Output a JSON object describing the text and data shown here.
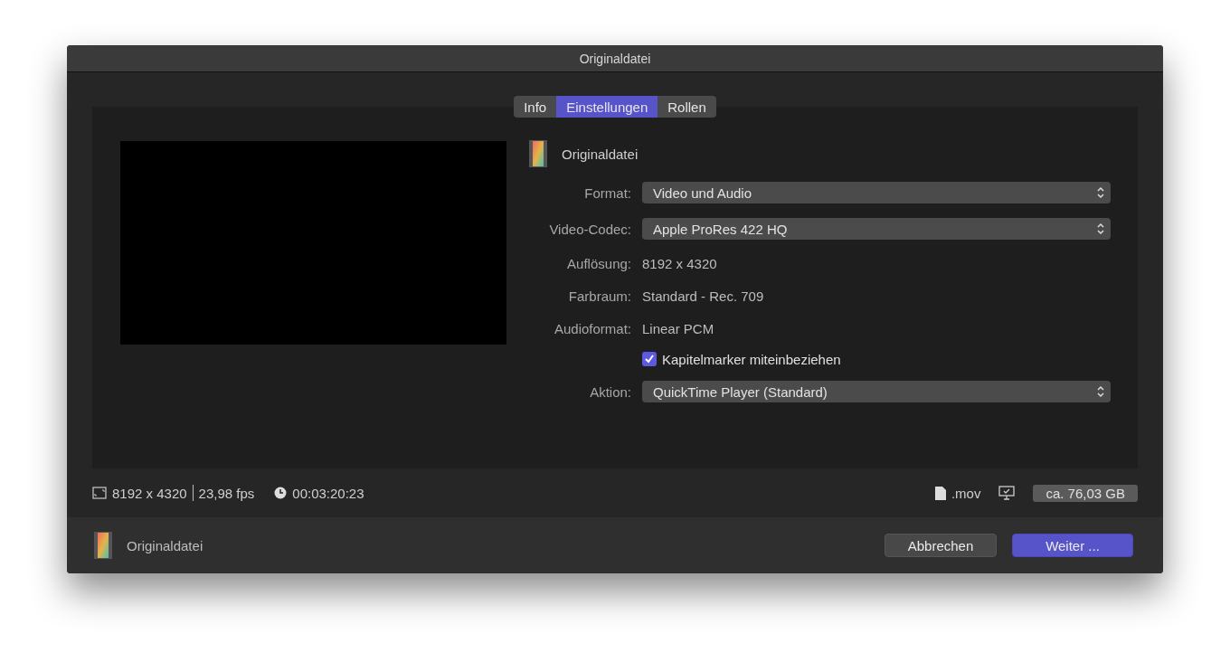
{
  "window": {
    "title": "Originaldatei"
  },
  "tabs": [
    {
      "label": "Info",
      "selected": false
    },
    {
      "label": "Einstellungen",
      "selected": true
    },
    {
      "label": "Rollen",
      "selected": false
    }
  ],
  "settings": {
    "heading": "Originaldatei",
    "fields": [
      {
        "kind": "popup",
        "label": "Format:",
        "value": "Video und Audio"
      },
      {
        "kind": "popup",
        "label": "Video-Codec:",
        "value": "Apple ProRes 422 HQ"
      },
      {
        "kind": "text",
        "label": "Auflösung:",
        "value": "8192 x 4320"
      },
      {
        "kind": "text",
        "label": "Farbraum:",
        "value": "Standard - Rec. 709"
      },
      {
        "kind": "text",
        "label": "Audioformat:",
        "value": "Linear PCM"
      },
      {
        "kind": "checkbox",
        "value": "Kapitelmarker miteinbeziehen",
        "checked": true
      },
      {
        "kind": "popup",
        "label": "Aktion:",
        "value": "QuickTime Player (Standard)"
      }
    ]
  },
  "status_bar": {
    "resolution": "8192 x 4320",
    "frame_rate": "23,98 fps",
    "duration": "00:03:20:23",
    "extension": ".mov",
    "size": "ca. 76,03 GB"
  },
  "footer": {
    "name": "Originaldatei",
    "buttons": [
      {
        "label": "Abbrechen",
        "kind": "secondary"
      },
      {
        "label": "Weiter ...",
        "kind": "primary"
      }
    ]
  }
}
